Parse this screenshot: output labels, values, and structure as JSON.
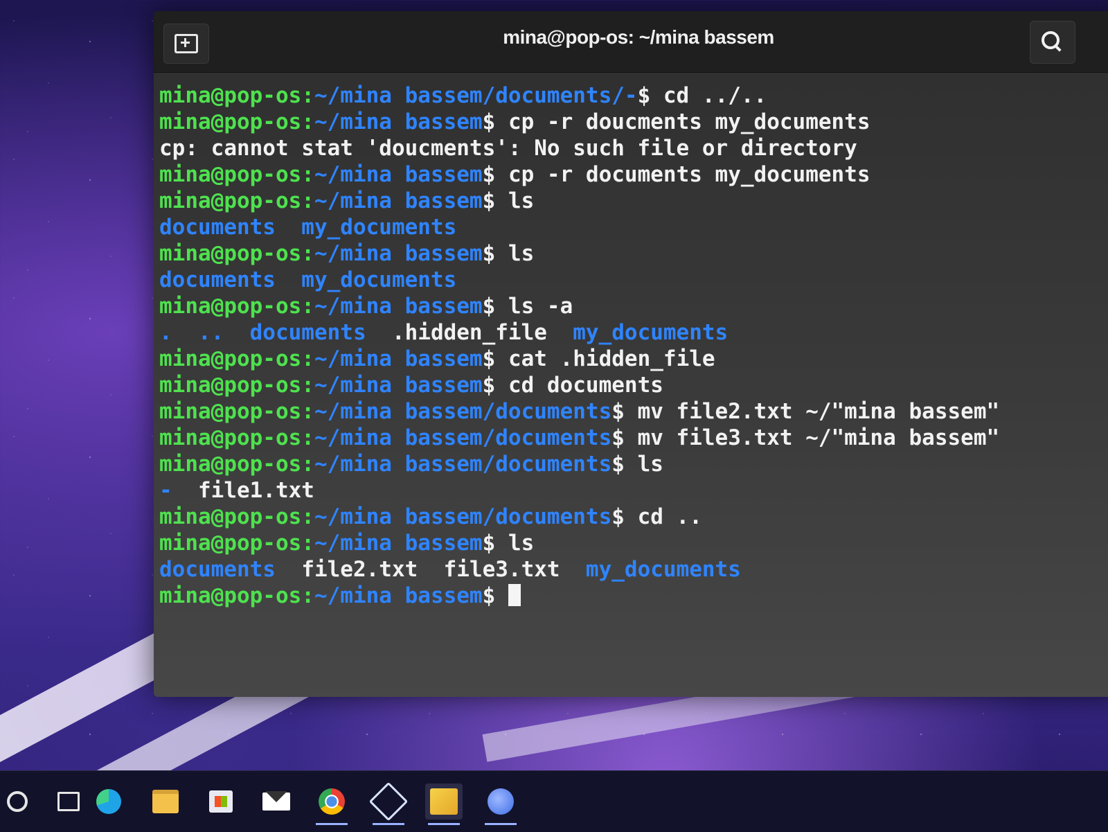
{
  "window": {
    "title": "mina@pop-os: ~/mina bassem",
    "new_tab_icon": "new-tab-icon",
    "search_icon": "search-icon"
  },
  "terminal": {
    "colors": {
      "user": "#4ee24e",
      "path": "#2f84ff",
      "dir": "#2f84ff",
      "text": "#f2f2f2"
    },
    "lines": [
      {
        "user": "mina@pop-os:",
        "path": "~/mina bassem/documents/-",
        "prompt": "$ ",
        "cmd": "cd ../.."
      },
      {
        "user": "mina@pop-os:",
        "path": "~/mina bassem",
        "prompt": "$ ",
        "cmd": "cp -r doucments my_documents"
      },
      {
        "text": "cp: cannot stat 'doucments': No such file or directory"
      },
      {
        "user": "mina@pop-os:",
        "path": "~/mina bassem",
        "prompt": "$ ",
        "cmd": "cp -r documents my_documents"
      },
      {
        "user": "mina@pop-os:",
        "path": "~/mina bassem",
        "prompt": "$ ",
        "cmd": "ls"
      },
      {
        "dirs": "documents  my_documents"
      },
      {
        "user": "mina@pop-os:",
        "path": "~/mina bassem",
        "prompt": "$ ",
        "cmd": "ls"
      },
      {
        "dirs": "documents  my_documents"
      },
      {
        "user": "mina@pop-os:",
        "path": "~/mina bassem",
        "prompt": "$ ",
        "cmd": "ls -a"
      },
      {
        "parts": [
          {
            "d": ".  ..  documents  "
          },
          {
            "t": ".hidden_file  "
          },
          {
            "d": "my_documents"
          }
        ]
      },
      {
        "user": "mina@pop-os:",
        "path": "~/mina bassem",
        "prompt": "$ ",
        "cmd": "cat .hidden_file"
      },
      {
        "user": "mina@pop-os:",
        "path": "~/mina bassem",
        "prompt": "$ ",
        "cmd": "cd documents"
      },
      {
        "user": "mina@pop-os:",
        "path": "~/mina bassem/documents",
        "prompt": "$ ",
        "cmd": "mv file2.txt ~/\"mina bassem\""
      },
      {
        "user": "mina@pop-os:",
        "path": "~/mina bassem/documents",
        "prompt": "$ ",
        "cmd": "mv file3.txt ~/\"mina bassem\""
      },
      {
        "user": "mina@pop-os:",
        "path": "~/mina bassem/documents",
        "prompt": "$ ",
        "cmd": "ls"
      },
      {
        "parts": [
          {
            "d": "-  "
          },
          {
            "t": "file1.txt"
          }
        ]
      },
      {
        "user": "mina@pop-os:",
        "path": "~/mina bassem/documents",
        "prompt": "$ ",
        "cmd": "cd .."
      },
      {
        "user": "mina@pop-os:",
        "path": "~/mina bassem",
        "prompt": "$ ",
        "cmd": "ls"
      },
      {
        "parts": [
          {
            "d": "documents  "
          },
          {
            "t": "file2.txt  file3.txt  "
          },
          {
            "d": "my_documents"
          }
        ]
      },
      {
        "user": "mina@pop-os:",
        "path": "~/mina bassem",
        "prompt": "$ ",
        "cmd": "",
        "cursor": true
      }
    ]
  },
  "taskbar": {
    "items": [
      {
        "name": "search-icon",
        "cls": "ic-search"
      },
      {
        "name": "task-view-icon",
        "cls": "ic-task"
      },
      {
        "name": "edge-browser-icon",
        "cls": "ic-edge"
      },
      {
        "name": "file-explorer-icon",
        "cls": "ic-folder"
      },
      {
        "name": "microsoft-store-icon",
        "cls": "ic-store"
      },
      {
        "name": "mail-icon",
        "cls": "ic-mail"
      },
      {
        "name": "chrome-browser-icon",
        "cls": "ic-chrome",
        "active": true
      },
      {
        "name": "virtualbox-icon",
        "cls": "ic-vbox",
        "active": true
      },
      {
        "name": "pinned-app-icon",
        "cls": "ic-app",
        "active": true,
        "selected": true
      },
      {
        "name": "messenger-icon",
        "cls": "ic-messenger",
        "active": true
      }
    ]
  }
}
